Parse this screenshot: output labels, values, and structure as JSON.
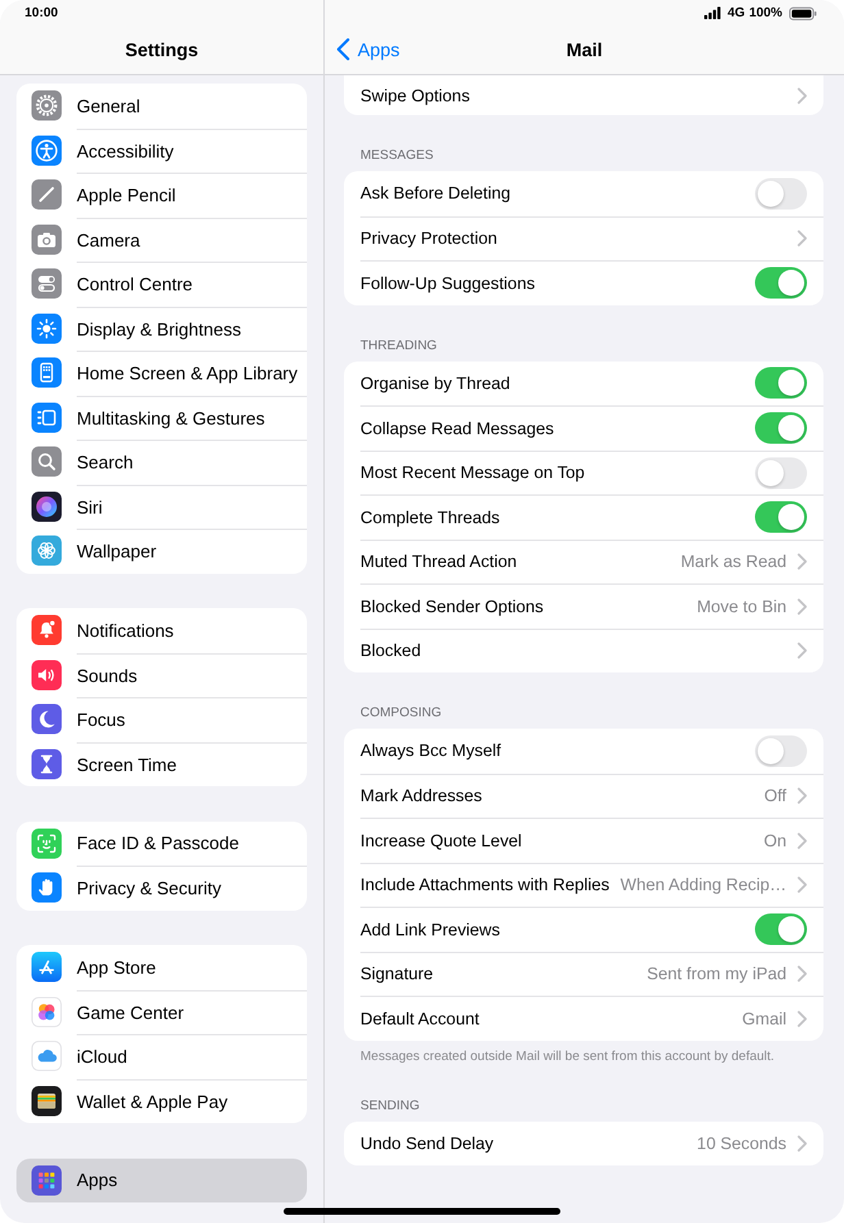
{
  "status_bar": {
    "time": "10:00",
    "network": "4G",
    "battery": "100%"
  },
  "sidebar": {
    "title": "Settings",
    "groups": [
      {
        "items": [
          {
            "label": "General",
            "selected": false
          },
          {
            "label": "Accessibility",
            "selected": false
          },
          {
            "label": "Apple Pencil",
            "selected": false
          },
          {
            "label": "Camera",
            "selected": false
          },
          {
            "label": "Control Centre",
            "selected": false
          },
          {
            "label": "Display & Brightness",
            "selected": false
          },
          {
            "label": "Home Screen & App Library",
            "selected": false
          },
          {
            "label": "Multitasking & Gestures",
            "selected": false
          },
          {
            "label": "Search",
            "selected": false
          },
          {
            "label": "Siri",
            "selected": false
          },
          {
            "label": "Wallpaper",
            "selected": false
          }
        ]
      },
      {
        "items": [
          {
            "label": "Notifications",
            "selected": false
          },
          {
            "label": "Sounds",
            "selected": false
          },
          {
            "label": "Focus",
            "selected": false
          },
          {
            "label": "Screen Time",
            "selected": false
          }
        ]
      },
      {
        "items": [
          {
            "label": "Face ID & Passcode",
            "selected": false
          },
          {
            "label": "Privacy & Security",
            "selected": false
          }
        ]
      },
      {
        "items": [
          {
            "label": "App Store",
            "selected": false
          },
          {
            "label": "Game Center",
            "selected": false
          },
          {
            "label": "iCloud",
            "selected": false
          },
          {
            "label": "Wallet & Apple Pay",
            "selected": false
          }
        ]
      },
      {
        "items": [
          {
            "label": "Apps",
            "selected": true
          }
        ]
      }
    ]
  },
  "detail": {
    "back": "Apps",
    "title": "Mail",
    "sections": [
      {
        "rows": [
          {
            "kind": "link",
            "label": "Swipe Options"
          }
        ]
      },
      {
        "header": "MESSAGES",
        "rows": [
          {
            "kind": "toggle",
            "label": "Ask Before Deleting",
            "on": false
          },
          {
            "kind": "link",
            "label": "Privacy Protection"
          },
          {
            "kind": "toggle",
            "label": "Follow-Up Suggestions",
            "on": true
          }
        ]
      },
      {
        "header": "THREADING",
        "rows": [
          {
            "kind": "toggle",
            "label": "Organise by Thread",
            "on": true
          },
          {
            "kind": "toggle",
            "label": "Collapse Read Messages",
            "on": true
          },
          {
            "kind": "toggle",
            "label": "Most Recent Message on Top",
            "on": false
          },
          {
            "kind": "toggle",
            "label": "Complete Threads",
            "on": true
          },
          {
            "kind": "link",
            "label": "Muted Thread Action",
            "value": "Mark as Read"
          },
          {
            "kind": "link",
            "label": "Blocked Sender Options",
            "value": "Move to Bin"
          },
          {
            "kind": "link",
            "label": "Blocked"
          }
        ]
      },
      {
        "header": "COMPOSING",
        "rows": [
          {
            "kind": "toggle",
            "label": "Always Bcc Myself",
            "on": false
          },
          {
            "kind": "link",
            "label": "Mark Addresses",
            "value": "Off"
          },
          {
            "kind": "link",
            "label": "Increase Quote Level",
            "value": "On"
          },
          {
            "kind": "link",
            "label": "Include Attachments with Replies",
            "value": "When Adding Recip…"
          },
          {
            "kind": "toggle",
            "label": "Add Link Previews",
            "on": true
          },
          {
            "kind": "link",
            "label": "Signature",
            "value": "Sent from my iPad"
          },
          {
            "kind": "link",
            "label": "Default Account",
            "value": "Gmail"
          }
        ],
        "footer": "Messages created outside Mail will be sent from this account by default."
      },
      {
        "header": "SENDING",
        "rows": [
          {
            "kind": "link",
            "label": "Undo Send Delay",
            "value": "10 Seconds"
          }
        ]
      }
    ]
  }
}
